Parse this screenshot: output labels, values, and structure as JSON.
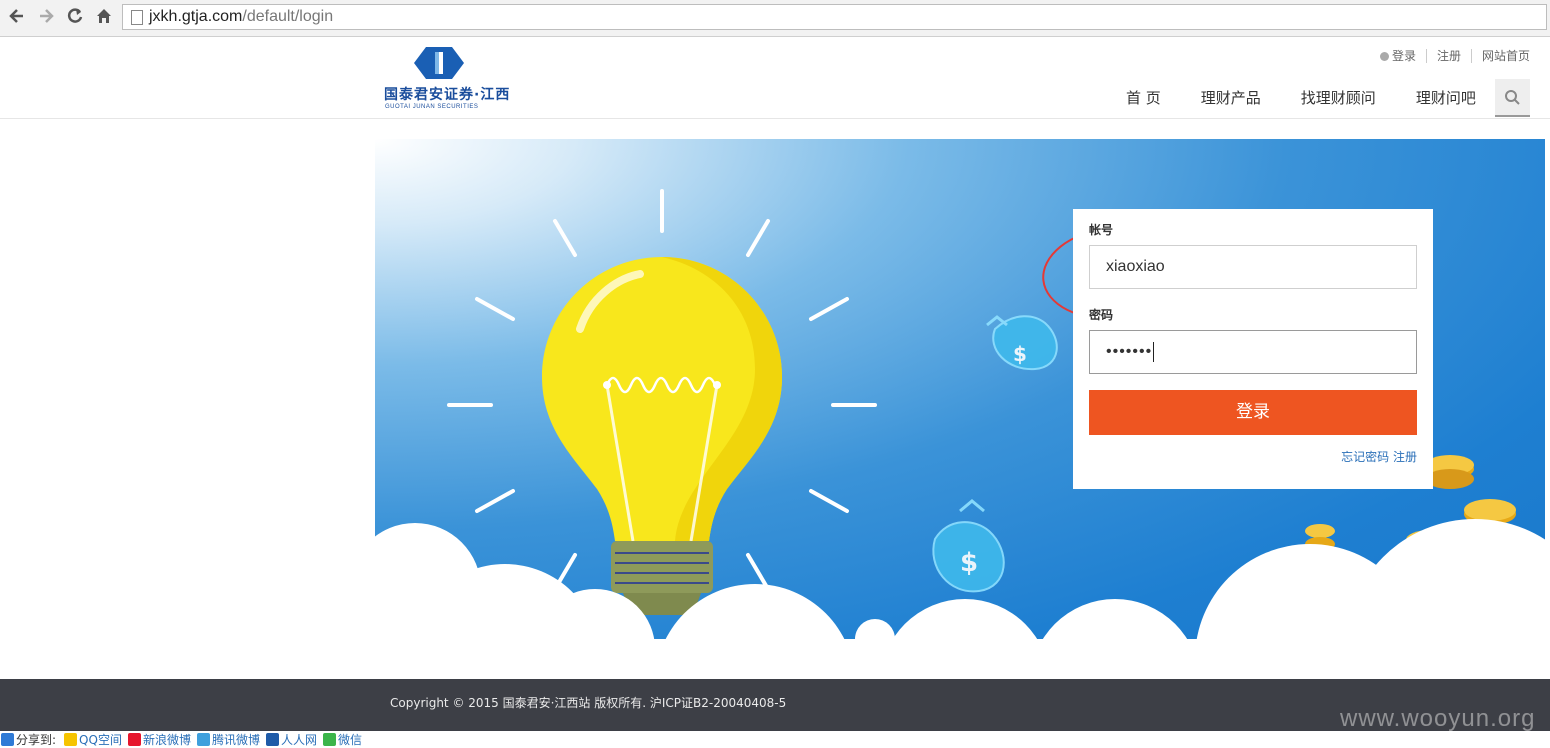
{
  "browser": {
    "url_host": "jxkh.gtja.com",
    "url_path": "/default/login"
  },
  "header": {
    "logo_text": "国泰君安证券·江西",
    "logo_sub": "GUOTAI JUNAN SECURITIES",
    "top_links": {
      "login": "登录",
      "register": "注册",
      "home": "网站首页"
    },
    "nav": [
      "首 页",
      "理财产品",
      "找理财顾问",
      "理财问吧"
    ]
  },
  "login": {
    "account_label": "帐号",
    "account_value": "xiaoxiao",
    "password_label": "密码",
    "password_value": "•••••••",
    "submit_label": "登录",
    "forgot_label": "忘记密码",
    "register_label": "注册"
  },
  "footer": {
    "copyright": "Copyright © 2015 国泰君安·江西站 版权所有. 沪ICP证B2-20040408-5",
    "watermark": "www.wooyun.org"
  },
  "share": {
    "label": "分享到:",
    "items": [
      "QQ空间",
      "新浪微博",
      "腾讯微博",
      "人人网",
      "微信"
    ]
  },
  "colors": {
    "brand_blue": "#1a4d9c",
    "banner_blue": "#1e7fd1",
    "button_orange": "#ee5521",
    "annotation_red": "#e53935"
  }
}
